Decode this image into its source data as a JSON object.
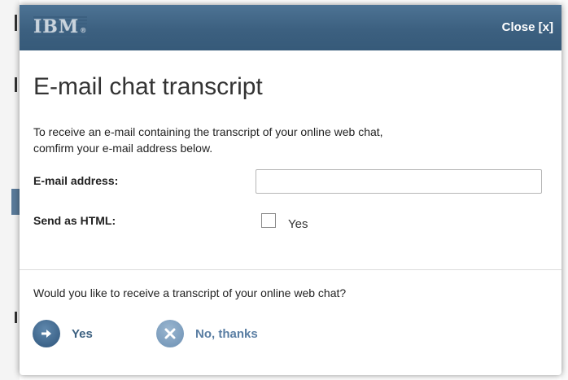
{
  "header": {
    "logo_text": "IBM",
    "logo_mark": "®",
    "close_label": "Close [x]"
  },
  "dialog": {
    "title": "E-mail chat transcript",
    "intro_line1": "To receive an e-mail containing the transcript of your online web chat,",
    "intro_line2": "comfirm your e-mail address below.",
    "email_label": "E-mail address:",
    "email_value": "",
    "html_label": "Send as HTML:",
    "html_checkbox_label": "Yes",
    "html_checked": false,
    "question": "Would you like to receive a transcript of your online web chat?",
    "yes_label": "Yes",
    "no_label": "No, thanks"
  },
  "colors": {
    "header": "#3c6080",
    "accent": "#3c6080",
    "button_secondary": "#6c90b3"
  },
  "icons": {
    "yes": "arrow-right-icon",
    "no": "x-icon"
  }
}
